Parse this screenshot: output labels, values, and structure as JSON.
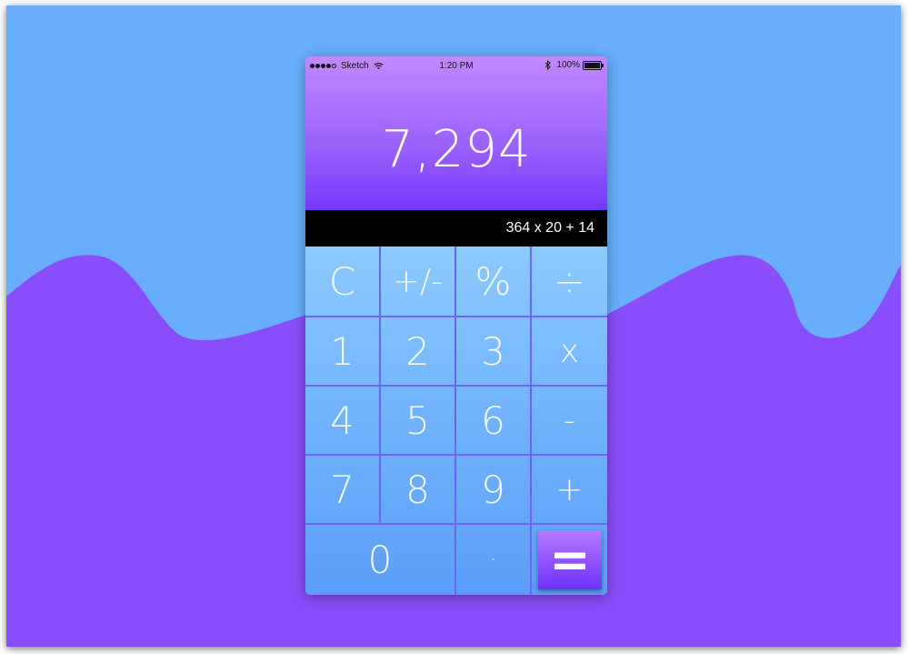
{
  "colors": {
    "sky": "#68aefc",
    "wave": "#8a4dfb",
    "display_top": "#c189ff",
    "display_bottom": "#7437fb",
    "expression_bar": "#000000",
    "key_divider": "#6f63f2",
    "equals_top": "#b57cff",
    "equals_bottom": "#6e33fb"
  },
  "status_bar": {
    "carrier": "Sketch",
    "time": "1:20 PM",
    "battery": "100%",
    "battery_level": 1.0,
    "signal_bars_filled": 4,
    "icons": [
      "signal-dots-icon",
      "wifi-icon",
      "bluetooth-icon",
      "battery-icon"
    ]
  },
  "display": {
    "result": "7,294",
    "expression": "364 x 20 + 14"
  },
  "keys": {
    "clear": "C",
    "plus_minus": "+/-",
    "percent": "%",
    "divide": "÷",
    "one": "1",
    "two": "2",
    "three": "3",
    "multiply": "x",
    "four": "4",
    "five": "5",
    "six": "6",
    "subtract": "-",
    "seven": "7",
    "eight": "8",
    "nine": "9",
    "add": "+",
    "zero": "0",
    "decimal": "·",
    "equals": "="
  }
}
